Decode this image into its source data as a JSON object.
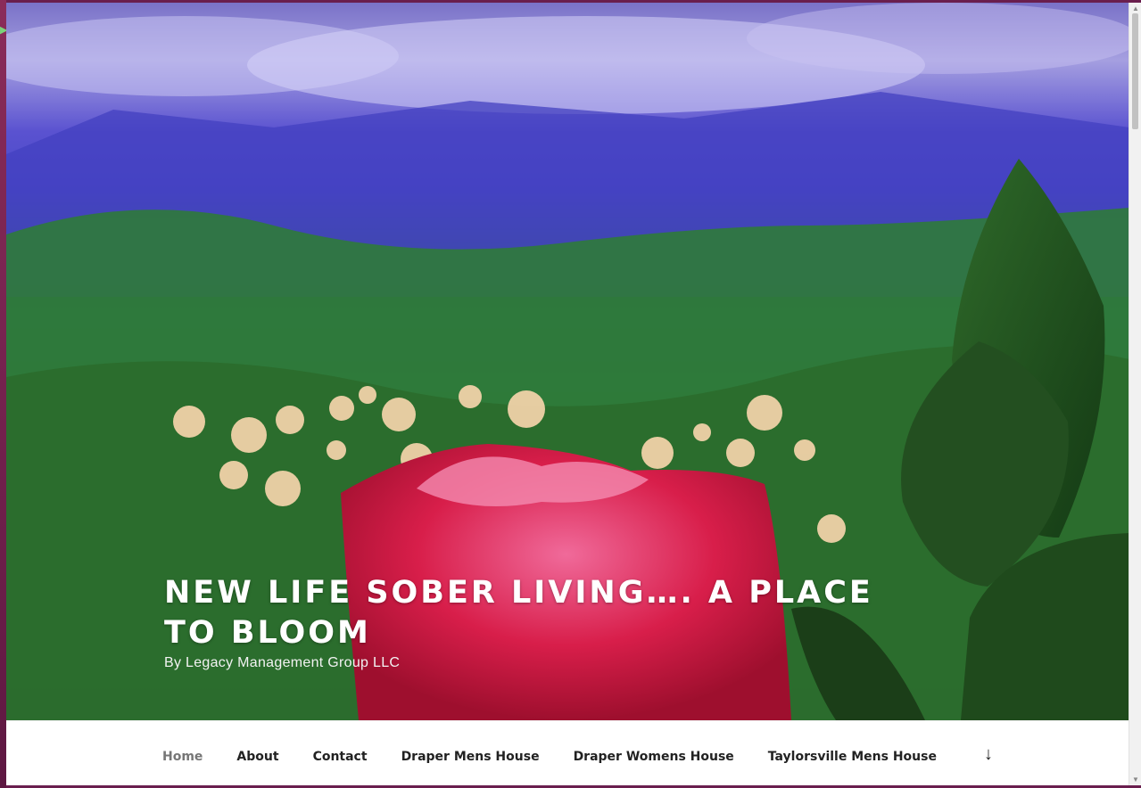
{
  "site": {
    "title": "NEW LIFE SOBER LIVING…. A PLACE TO BLOOM",
    "description": "By Legacy Management Group LLC"
  },
  "nav": {
    "items": [
      {
        "label": "Home"
      },
      {
        "label": "About"
      },
      {
        "label": "Contact"
      },
      {
        "label": "Draper Mens House"
      },
      {
        "label": "Draper Womens House"
      },
      {
        "label": "Taylorsville Mens House"
      }
    ],
    "scroll_icon": "arrow-down-icon"
  },
  "colors": {
    "accent": "#767676",
    "text": "#222222",
    "rose": "#d81e4a"
  }
}
